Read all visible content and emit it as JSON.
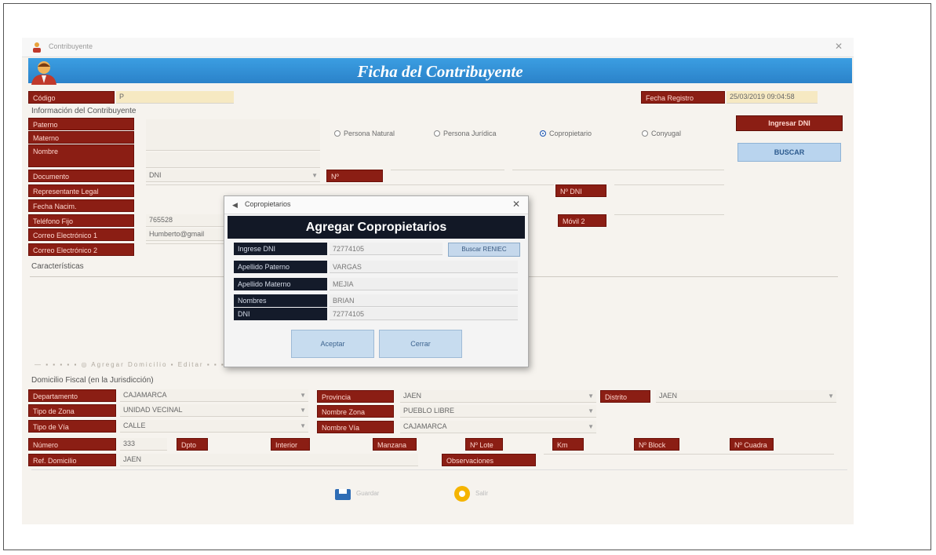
{
  "window": {
    "title": "Contribuyente"
  },
  "banner": {
    "title": "Ficha del Contribuyente"
  },
  "header": {
    "codigo_label": "Código",
    "codigo_value": "P",
    "fecha_label": "Fecha Registro",
    "fecha_value": "25/03/2019 09:04:58"
  },
  "info": {
    "section_title": "Información del Contribuyente",
    "paterno_label": "Paterno",
    "materno_label": "Materno",
    "nombre_label": "Nombre",
    "documento_label": "Documento",
    "documento_value": "DNI",
    "num_label": "Nº",
    "representante_label": "Representante Legal",
    "ndni_label": "Nº DNI",
    "fecha_nac_label": "Fecha Nacim.",
    "telefono_label": "Teléfono Fijo",
    "telefono_value": "765528",
    "movil_label": "Móvil 2",
    "correo1_label": "Correo Electrónico 1",
    "correo1_value": "Humberto@gmail",
    "correo2_label": "Correo Electrónico 2",
    "caracteristicas_label": "Características"
  },
  "person_types": [
    {
      "label": "Persona Natural",
      "selected": false
    },
    {
      "label": "Persona Jurídica",
      "selected": false
    },
    {
      "label": "Copropietario",
      "selected": true
    },
    {
      "label": "Conyugal",
      "selected": false
    }
  ],
  "right_buttons": {
    "ingresar": "Ingresar DNI",
    "buscar": "BUSCAR"
  },
  "toolbar_strip": "— ▪ ▪   ▪ ▪ ▪  ◎ Agregar Domicilio   ▪ Editar ▪   ▪ ▪",
  "domicilio": {
    "section_title": "Domicilio Fiscal (en la Jurisdicción)",
    "departamento_label": "Departamento",
    "departamento_value": "CAJAMARCA",
    "provincia_label": "Provincia",
    "provincia_value": "JAEN",
    "distrito_label": "Distrito",
    "distrito_value": "JAEN",
    "tipo_zona_label": "Tipo de Zona",
    "tipo_zona_value": "UNIDAD VECINAL",
    "nombre_zona_label": "Nombre Zona",
    "nombre_zona_value": "PUEBLO LIBRE",
    "tipo_via_label": "Tipo de Vía",
    "tipo_via_value": "CALLE",
    "nombre_via_label": "Nombre Vía",
    "nombre_via_value": "CAJAMARCA",
    "numero_label": "Número",
    "numero_value": "333",
    "small_labels": [
      "Dpto",
      "Interior",
      "Manzana",
      "Nº Lote",
      "Km",
      "Nº Block",
      "Nº Cuadra"
    ],
    "ref_label": "Ref. Domicilio",
    "ref_value": "JAEN",
    "observaciones_label": "Observaciones"
  },
  "bottom": {
    "save_label": "Guardar",
    "exit_label": "Salir"
  },
  "dialog": {
    "title": "Copropietarios",
    "header": "Agregar Copropietarios",
    "fields": [
      {
        "label": "Ingrese DNI",
        "value": "72774105"
      },
      {
        "label": "Apellido Paterno",
        "value": "VARGAS"
      },
      {
        "label": "Apellido Materno",
        "value": "MEJIA"
      },
      {
        "label": "Nombres",
        "value": "BRIAN"
      },
      {
        "label": "DNI",
        "value": "72774105"
      }
    ],
    "search_button": "Buscar RENIEC",
    "accept_button": "Aceptar",
    "cancel_button": "Cerrar"
  },
  "colors": {
    "banner": "#2b82c9",
    "label_bg": "#8b1e14",
    "dialog_label_bg": "#141b2a"
  }
}
